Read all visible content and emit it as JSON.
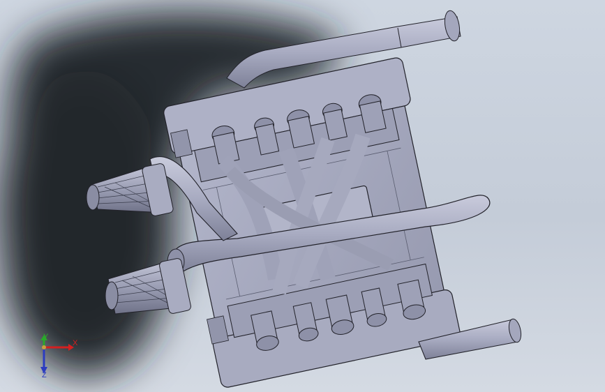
{
  "view": {
    "background_top": "#ced6e1",
    "background_bottom": "#d4dae3",
    "model_color": "#a4a7bd",
    "edge_color": "#22222a"
  },
  "triad": {
    "x_label": "X",
    "y_label": "Y",
    "z_label": "Z",
    "x_color": "#d42020",
    "y_color": "#2aa82a",
    "z_color": "#2c3cc0"
  }
}
